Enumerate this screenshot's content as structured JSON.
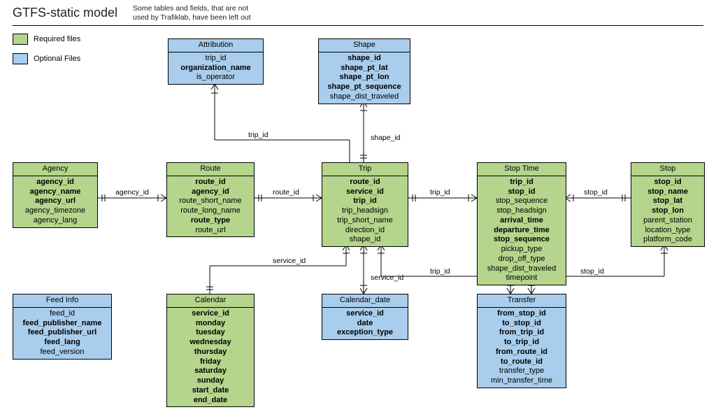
{
  "title": "GTFS-static model",
  "subtitle_line1": "Some tables and fields, that are not",
  "subtitle_line2": "used by Trafiklab, have been left out",
  "legend": {
    "required": "Required files",
    "optional": "Optional Files"
  },
  "entities": {
    "attribution": {
      "name": "Attribution",
      "fields": [
        "trip_id",
        "organization_name",
        "is_operator"
      ],
      "bold": [
        false,
        true,
        false
      ]
    },
    "shape": {
      "name": "Shape",
      "fields": [
        "shape_id",
        "shape_pt_lat",
        "shape_pt_lon",
        "shape_pt_sequence",
        "shape_dist_traveled"
      ],
      "bold": [
        true,
        true,
        true,
        true,
        false
      ]
    },
    "agency": {
      "name": "Agency",
      "fields": [
        "agency_id",
        "agency_name",
        "agency_url",
        "agency_timezone",
        "agency_lang"
      ],
      "bold": [
        true,
        true,
        true,
        false,
        false
      ]
    },
    "route": {
      "name": "Route",
      "fields": [
        "route_id",
        "agency_id",
        "route_short_name",
        "route_long_name",
        "route_type",
        "route_url"
      ],
      "bold": [
        true,
        true,
        false,
        false,
        true,
        false
      ]
    },
    "trip": {
      "name": "Trip",
      "fields": [
        "route_id",
        "service_id",
        "trip_id",
        "trip_headsign",
        "trip_short_name",
        "direction_id",
        "shape_id"
      ],
      "bold": [
        true,
        true,
        true,
        false,
        false,
        false,
        false
      ]
    },
    "stoptime": {
      "name": "Stop Time",
      "fields": [
        "trip_id",
        "stop_id",
        "stop_sequence",
        "stop_headsign",
        "arrival_time",
        "departure_time",
        "stop_sequence",
        "pickup_type",
        "drop_off_type",
        "shape_dist_traveled",
        "timepoint"
      ],
      "bold": [
        true,
        true,
        false,
        false,
        true,
        true,
        true,
        false,
        false,
        false,
        false
      ]
    },
    "stop": {
      "name": "Stop",
      "fields": [
        "stop_id",
        "stop_name",
        "stop_lat",
        "stop_lon",
        "parent_station",
        "location_type",
        "platform_code"
      ],
      "bold": [
        true,
        true,
        true,
        true,
        false,
        false,
        false
      ]
    },
    "feedinfo": {
      "name": "Feed Info",
      "fields": [
        "feed_id",
        "feed_publisher_name",
        "feed_publisher_url",
        "feed_lang",
        "feed_version"
      ],
      "bold": [
        false,
        true,
        true,
        true,
        false
      ]
    },
    "calendar": {
      "name": "Calendar",
      "fields": [
        "service_id",
        "monday",
        "tuesday",
        "wednesday",
        "thursday",
        "friday",
        "saturday",
        "sunday",
        "start_date",
        "end_date"
      ],
      "bold": [
        true,
        true,
        true,
        true,
        true,
        true,
        true,
        true,
        true,
        true
      ]
    },
    "calendardate": {
      "name": "Calendar_date",
      "fields": [
        "service_id",
        "date",
        "exception_type"
      ],
      "bold": [
        true,
        true,
        true
      ]
    },
    "transfer": {
      "name": "Transfer",
      "fields": [
        "from_stop_id",
        "to_stop_id",
        "from_trip_id",
        "to_trip_id",
        "from_route_id",
        "to_route_id",
        "transfer_type",
        "min_transfer_time"
      ],
      "bold": [
        true,
        true,
        true,
        true,
        true,
        true,
        false,
        false
      ]
    }
  },
  "connectors": {
    "attr_trip": "trip_id",
    "shape_trip": "shape_id",
    "agency_route": "agency_id",
    "route_trip": "route_id",
    "trip_st": "trip_id",
    "st_stop": "stop_id",
    "trip_cal": "service_id",
    "trip_cd": "service_id",
    "trip_trans": "trip_id",
    "stop_trans": "stop_id"
  }
}
